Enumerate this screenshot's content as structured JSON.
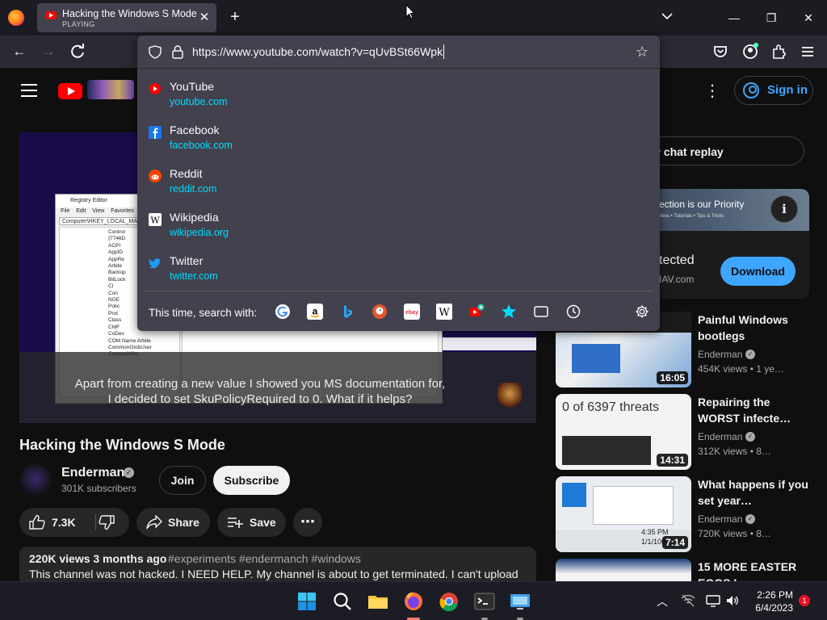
{
  "browser": {
    "tab": {
      "title": "Hacking the Windows S Mode",
      "status": "PLAYING"
    },
    "new_tab_label": "+",
    "window_controls": {
      "minimize": "—",
      "maximize": "❐",
      "close": "✕"
    }
  },
  "urlbar": {
    "value": "https://www.youtube.com/watch?v=qUvBSt66Wpk",
    "suggestions": [
      {
        "title": "YouTube",
        "url": "youtube.com",
        "icon": "youtube-icon",
        "color": "#ff0000"
      },
      {
        "title": "Facebook",
        "url": "facebook.com",
        "icon": "facebook-icon",
        "color": "#1877f2"
      },
      {
        "title": "Reddit",
        "url": "reddit.com",
        "icon": "reddit-icon",
        "color": "#ff4500"
      },
      {
        "title": "Wikipedia",
        "url": "wikipedia.org",
        "icon": "wikipedia-icon",
        "color": "#ffffff"
      },
      {
        "title": "Twitter",
        "url": "twitter.com",
        "icon": "twitter-icon",
        "color": "#1d9bf0"
      }
    ],
    "search_with_label": "This time, search with:",
    "engines": [
      "google-icon",
      "amazon-icon",
      "bing-icon",
      "duckduckgo-icon",
      "ebay-icon",
      "wikipedia-icon",
      "youtube-add-icon",
      "bookmarks-icon",
      "tabs-icon",
      "history-icon"
    ]
  },
  "youtube": {
    "sign_in": "Sign in",
    "video": {
      "caption": "Apart from creating a new value I showed you MS documentation for,\nI decided to set SkuPolicyRequired to 0. What if it helps?",
      "title": "Hacking the Windows S Mode",
      "channel": "Enderman",
      "subscribers": "301K subscribers",
      "join": "Join",
      "subscribe": "Subscribe",
      "likes": "7.3K",
      "share": "Share",
      "save": "Save",
      "stats": "220K views  3 months ago",
      "tags": "#experiments #endermanch #windows",
      "description": "This channel was not hacked. I NEED HELP. My channel is about to get terminated. I can't upload"
    },
    "regedit": {
      "title": "Registry Editor",
      "menu": "File Edit View Favorites",
      "address": "Computer\\HKEY_LOCAL_MA",
      "tree": [
        "Control",
        "{7746D",
        "ACPI",
        "AppID",
        "AppRe",
        "Arbite",
        "Backup",
        "BitLock",
        "CI",
        "Con",
        "NGE",
        "Polic",
        "Prot",
        "Class",
        "CMF",
        "CoDev",
        "COM Name Arbite",
        "CommonGlobUser",
        "Compatibility"
      ]
    },
    "chat_replay": "w chat replay",
    "ad": {
      "banner_text": "ection is our Priority",
      "banner_sub": "deos • Tutorials • Tips & Tricks",
      "title": "tected",
      "domain": "IAV.com",
      "button": "Download"
    },
    "recommendations": [
      {
        "title": "Painful Windows bootlegs",
        "channel": "Enderman",
        "meta": "454K views  • 1 ye…",
        "duration": "16:05"
      },
      {
        "title": "Repairing the WORST infecte…",
        "channel": "Enderman",
        "meta": "312K views  • 8…",
        "duration": "14:31",
        "thumb_text": "0 of 6397 threats"
      },
      {
        "title": "What happens if you set year…",
        "channel": "Enderman",
        "meta": "720K views  • 8…",
        "duration": "7:14",
        "thumb_time": "4:35 PM",
        "thumb_date": "1/1/100"
      },
      {
        "title": "15 MORE EASTER EGGS I…",
        "channel": "",
        "meta": "",
        "duration": ""
      }
    ]
  },
  "taskbar": {
    "apps": [
      "windows-start-icon",
      "search-icon",
      "file-explorer-icon",
      "firefox-icon",
      "chrome-icon",
      "terminal-icon",
      "remote-desktop-icon"
    ],
    "time": "2:26 PM",
    "date": "6/4/2023",
    "notifications": "1"
  },
  "colors": {
    "accent_blue": "#3ea6ff",
    "url_cyan": "#00ddff",
    "yt_red": "#ff0000",
    "panel": "#42414d"
  }
}
